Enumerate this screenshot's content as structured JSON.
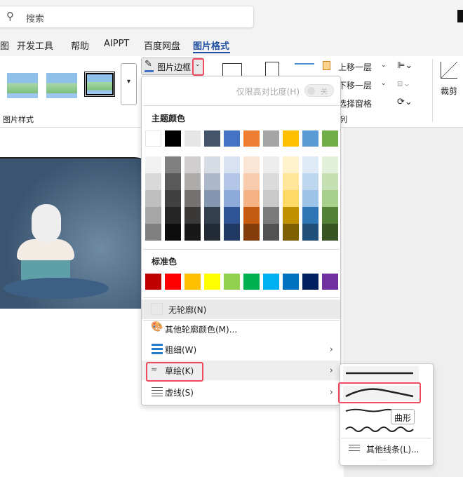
{
  "search": {
    "placeholder": "搜索"
  },
  "tabs": [
    "图",
    "开发工具",
    "帮助",
    "AIPPT",
    "百度网盘",
    "图片格式"
  ],
  "ribbon": {
    "group_label_styles": "图片样式",
    "border_button": "图片边框",
    "bring_forward": "上移一层",
    "send_backward": "下移一层",
    "selection_pane": "选择窗格",
    "arrange_label": "列",
    "crop": "裁剪"
  },
  "menu": {
    "high_contrast": "仅限高对比度(H)",
    "toggle_state": "关",
    "theme_colors_label": "主题颜色",
    "theme_colors": [
      "#ffffff",
      "#000000",
      "#e7e6e6",
      "#44546a",
      "#4472c4",
      "#ed7d31",
      "#a5a5a5",
      "#ffc000",
      "#5b9bd5",
      "#70ad47"
    ],
    "theme_shades": [
      [
        "#f2f2f2",
        "#d9d9d9",
        "#bfbfbf",
        "#a6a6a6",
        "#808080"
      ],
      [
        "#808080",
        "#595959",
        "#404040",
        "#262626",
        "#0d0d0d"
      ],
      [
        "#d0cece",
        "#aeabab",
        "#757171",
        "#3b3838",
        "#181717"
      ],
      [
        "#d6dce4",
        "#adb9ca",
        "#8497b0",
        "#333f4f",
        "#222a35"
      ],
      [
        "#d9e2f3",
        "#b4c6e7",
        "#8eaadb",
        "#2f5496",
        "#1f3864"
      ],
      [
        "#fbe5d5",
        "#f7cbac",
        "#f4b183",
        "#c55a11",
        "#843c0b"
      ],
      [
        "#ededed",
        "#dbdbdb",
        "#c9c9c9",
        "#7b7b7b",
        "#525252"
      ],
      [
        "#fff2cc",
        "#ffe699",
        "#ffd966",
        "#bf9000",
        "#7f6000"
      ],
      [
        "#deebf6",
        "#bdd7ee",
        "#9dc3e6",
        "#2e75b5",
        "#1f4e79"
      ],
      [
        "#e2efd9",
        "#c5e0b3",
        "#a8d08d",
        "#538135",
        "#375623"
      ]
    ],
    "standard_colors_label": "标准色",
    "standard_colors": [
      "#c00000",
      "#ff0000",
      "#ffc000",
      "#ffff00",
      "#92d050",
      "#00b050",
      "#00b0f0",
      "#0070c0",
      "#002060",
      "#7030a0"
    ],
    "no_outline": "无轮廓(N)",
    "more_colors": "其他轮廓颜色(M)...",
    "weight": "粗细(W)",
    "sketched": "草绘(K)",
    "dashes": "虚线(S)"
  },
  "submenu": {
    "tooltip": "曲形",
    "more_lines": "其他线条(L)..."
  }
}
